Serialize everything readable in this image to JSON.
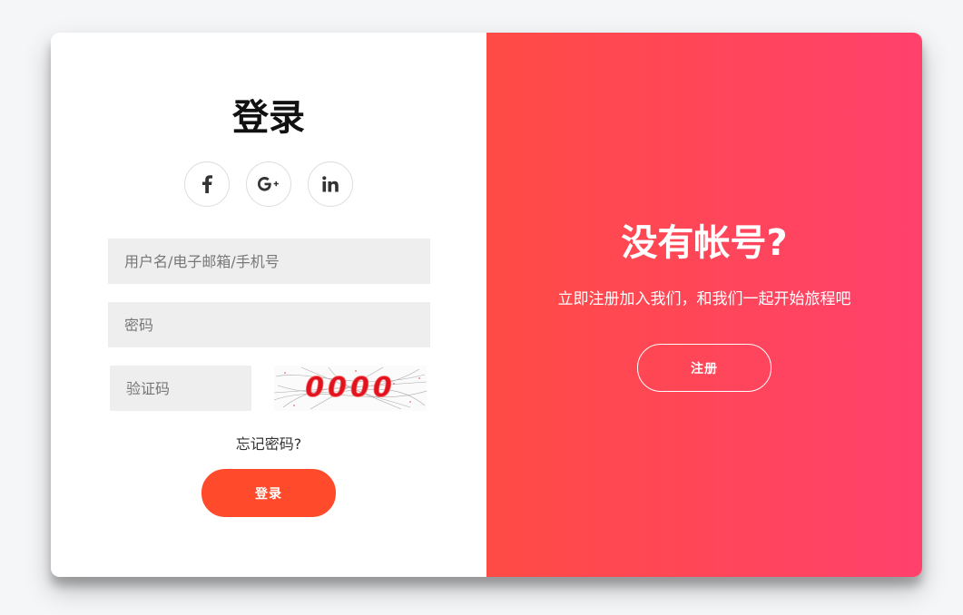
{
  "login": {
    "title": "登录",
    "social": [
      {
        "icon": "facebook-icon",
        "text": "f"
      },
      {
        "icon": "google-plus-icon",
        "text": "G+"
      },
      {
        "icon": "linkedin-icon",
        "text": "in"
      }
    ],
    "username_placeholder": "用户名/电子邮箱/手机号",
    "password_placeholder": "密码",
    "captcha_placeholder": "验证码",
    "captcha_text": "0000",
    "forgot_label": "忘记密码?",
    "button_label": "登录"
  },
  "signup": {
    "title": "没有帐号?",
    "description": "立即注册加入我们，和我们一起开始旅程吧",
    "button_label": "注册"
  },
  "colors": {
    "accent": "#ff4b2b",
    "gradient_start": "#ff4b45",
    "gradient_end": "#ff416c",
    "input_bg": "#eeeeee"
  }
}
